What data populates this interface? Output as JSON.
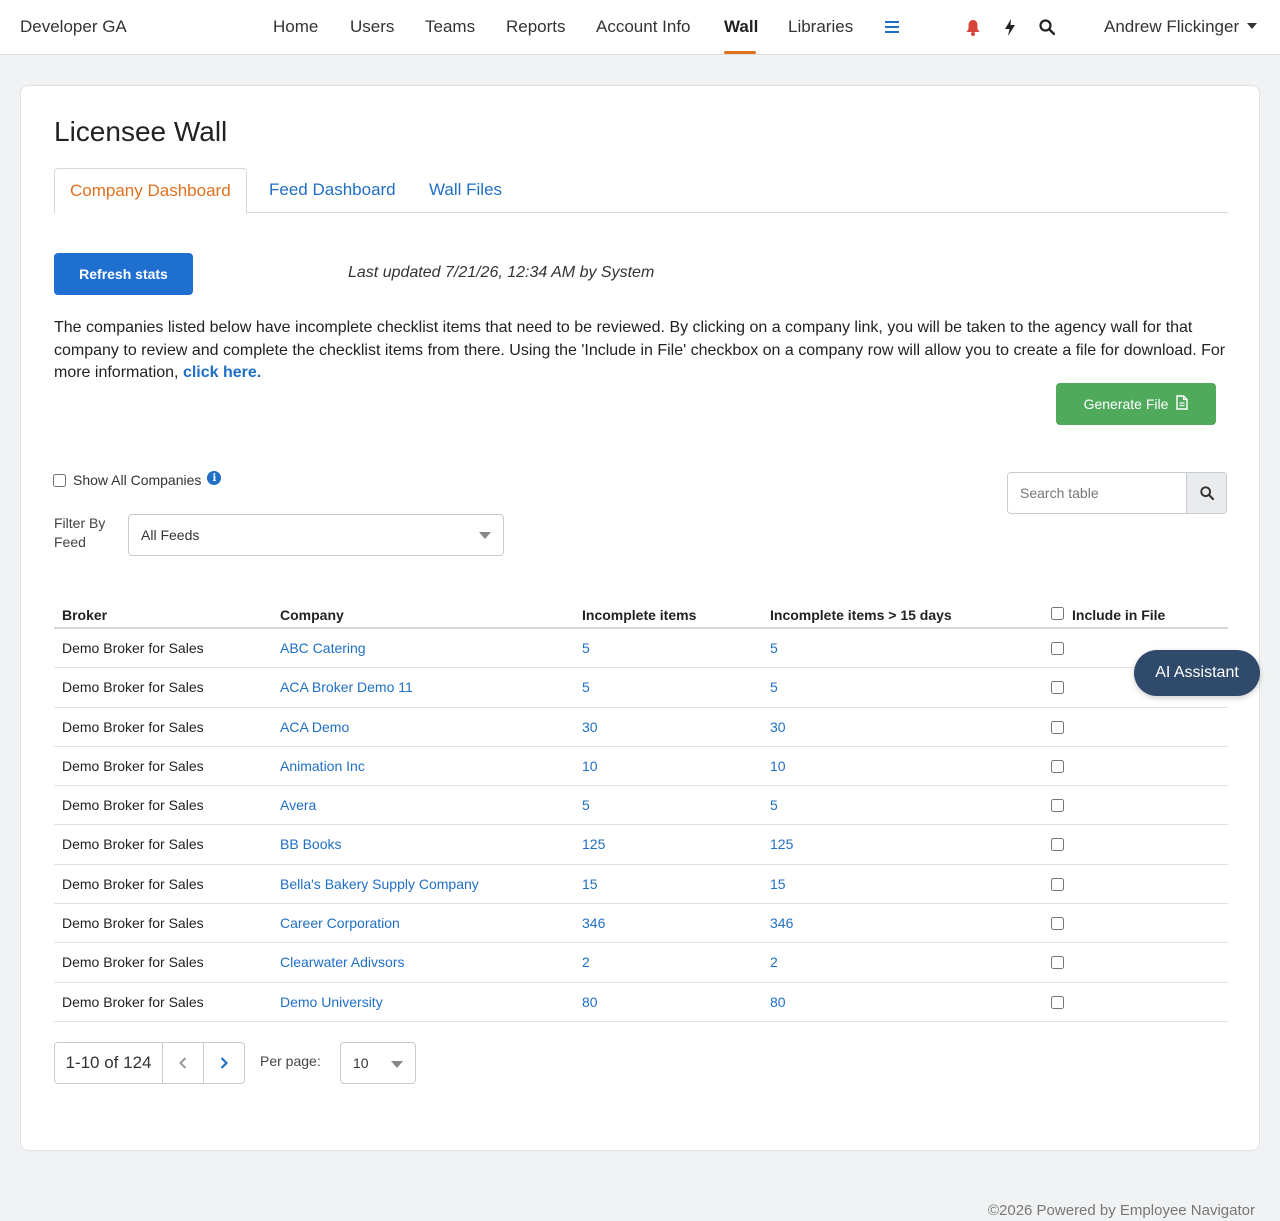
{
  "nav": {
    "brand": "Developer GA",
    "items": [
      {
        "label": "Home"
      },
      {
        "label": "Users"
      },
      {
        "label": "Teams"
      },
      {
        "label": "Reports"
      },
      {
        "label": "Account Info"
      },
      {
        "label": "Wall",
        "active": true
      },
      {
        "label": "Libraries"
      }
    ],
    "user_name": "Andrew Flickinger",
    "icons": [
      "menu-icon",
      "bell-icon",
      "bolt-icon",
      "search-icon"
    ],
    "accent_color": "#e0701f"
  },
  "page": {
    "title": "Licensee Wall",
    "tabs": [
      {
        "label": "Company Dashboard",
        "active": true
      },
      {
        "label": "Feed Dashboard"
      },
      {
        "label": "Wall Files"
      }
    ],
    "refresh_label": "Refresh stats",
    "last_updated": "Last updated 7/21/26, 12:34 AM by System",
    "description": "The companies listed below have incomplete checklist items that need to be reviewed. By clicking on a company link, you will be taken to the agency wall for that company to review and complete the checklist items from there. Using the 'Include in File' checkbox on a company row will allow you to create a file for download. For more information, ",
    "description_link": "click here.",
    "generate_label": "Generate File",
    "show_all_label": "Show All Companies",
    "search_placeholder": "Search table",
    "filter_label": "Filter By Feed",
    "filter_value": "All Feeds"
  },
  "table": {
    "headers": [
      "Broker",
      "Company",
      "Incomplete items",
      "Incomplete items > 15 days",
      "Include in File"
    ],
    "rows": [
      {
        "broker": "Demo Broker for Sales",
        "company": "ABC Catering",
        "incomplete": "5",
        "incomplete_15": "5"
      },
      {
        "broker": "Demo Broker for Sales",
        "company": "ACA Broker Demo 11",
        "incomplete": "5",
        "incomplete_15": "5"
      },
      {
        "broker": "Demo Broker for Sales",
        "company": "ACA Demo",
        "incomplete": "30",
        "incomplete_15": "30"
      },
      {
        "broker": "Demo Broker for Sales",
        "company": "Animation Inc",
        "incomplete": "10",
        "incomplete_15": "10"
      },
      {
        "broker": "Demo Broker for Sales",
        "company": "Avera",
        "incomplete": "5",
        "incomplete_15": "5"
      },
      {
        "broker": "Demo Broker for Sales",
        "company": "BB Books",
        "incomplete": "125",
        "incomplete_15": "125"
      },
      {
        "broker": "Demo Broker for Sales",
        "company": "Bella's Bakery Supply Company",
        "incomplete": "15",
        "incomplete_15": "15"
      },
      {
        "broker": "Demo Broker for Sales",
        "company": "Career Corporation",
        "incomplete": "346",
        "incomplete_15": "346"
      },
      {
        "broker": "Demo Broker for Sales",
        "company": "Clearwater Adivsors",
        "incomplete": "2",
        "incomplete_15": "2"
      },
      {
        "broker": "Demo Broker for Sales",
        "company": "Demo University",
        "incomplete": "80",
        "incomplete_15": "80"
      }
    ]
  },
  "pagination": {
    "range": "1-10 of 124",
    "per_page_label": "Per page:",
    "per_page_value": "10"
  },
  "ai_assistant_label": "AI Assistant",
  "footer": "©2026 Powered by Employee Navigator"
}
